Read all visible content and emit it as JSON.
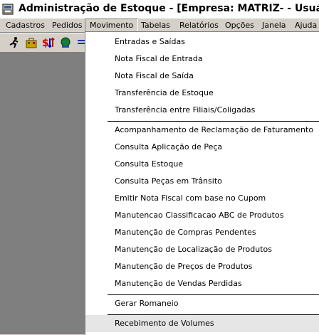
{
  "window": {
    "title": "Administração de Estoque - [Empresa: MATRIZ- - Usuário: ACAO INFORMATICA]"
  },
  "menubar": {
    "items": [
      {
        "label": "Cadastros"
      },
      {
        "label": "Pedidos"
      },
      {
        "label": "Movimento"
      },
      {
        "label": "Tabelas"
      },
      {
        "label": "Relatórios"
      },
      {
        "label": "Opções"
      },
      {
        "label": "Janela"
      },
      {
        "label": "Ajuda"
      }
    ]
  },
  "toolbar": {
    "icons": [
      "runner-icon",
      "briefcase-icon",
      "dollar-arrows-icon",
      "monitor-icon",
      "list-icon"
    ]
  },
  "dropdown": {
    "group1": [
      {
        "label": "Entradas e Saídas"
      },
      {
        "label": "Nota Fiscal de Entrada"
      },
      {
        "label": "Nota Fiscal de Saída"
      },
      {
        "label": "Transferência de Estoque"
      },
      {
        "label": "Transferência entre Filiais/Coligadas"
      }
    ],
    "group2": [
      {
        "label": "Acompanhamento de Reclamação de Faturamento"
      },
      {
        "label": "Consulta Aplicação de Peça"
      },
      {
        "label": "Consulta Estoque"
      },
      {
        "label": "Consulta Peças em Trânsito"
      },
      {
        "label": "Emitir Nota Fiscal com base no Cupom"
      },
      {
        "label": "Manutencao Classificacao ABC de Produtos"
      },
      {
        "label": "Manutenção de Compras Pendentes"
      },
      {
        "label": "Manutenção de Localização de Produtos"
      },
      {
        "label": "Manutenção de Preços de Produtos"
      },
      {
        "label": "Manutenção de Vendas Perdidas"
      }
    ],
    "group3": [
      {
        "label": "Gerar Romaneio"
      }
    ],
    "group4": [
      {
        "label": "Recebimento de Volumes"
      }
    ]
  },
  "colors": {
    "workspace": "#808080",
    "menu_bg": "#ffffff",
    "chrome": "#d4d0c8"
  }
}
